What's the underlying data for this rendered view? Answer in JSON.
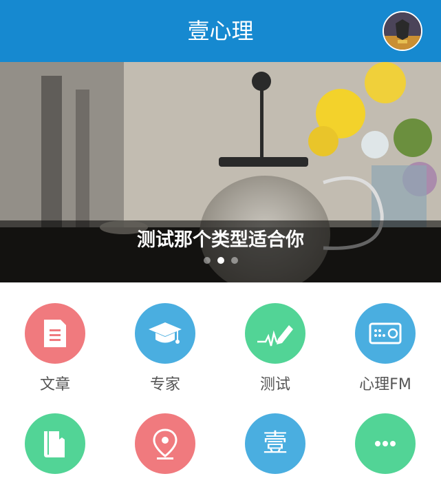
{
  "header": {
    "title": "壹心理",
    "avatar_icon": "avatar-image"
  },
  "banner": {
    "caption": "测试那个类型适合你",
    "slide_count": 3,
    "active_slide": 2
  },
  "menu": [
    {
      "label": "文章",
      "icon": "document-icon",
      "color": "#f07a7e"
    },
    {
      "label": "专家",
      "icon": "graduation-cap-icon",
      "color": "#4aaee0"
    },
    {
      "label": "测试",
      "icon": "pen-wave-icon",
      "color": "#52d496"
    },
    {
      "label": "心理FM",
      "icon": "radio-icon",
      "color": "#4aaee0"
    },
    {
      "label": "",
      "icon": "book-icon",
      "color": "#52d496"
    },
    {
      "label": "",
      "icon": "location-pin-icon",
      "color": "#f07a7e"
    },
    {
      "label": "",
      "icon": "yi-logo-icon",
      "glyph": "壹",
      "color": "#4aaee0"
    },
    {
      "label": "",
      "icon": "more-icon",
      "color": "#52d496"
    }
  ]
}
